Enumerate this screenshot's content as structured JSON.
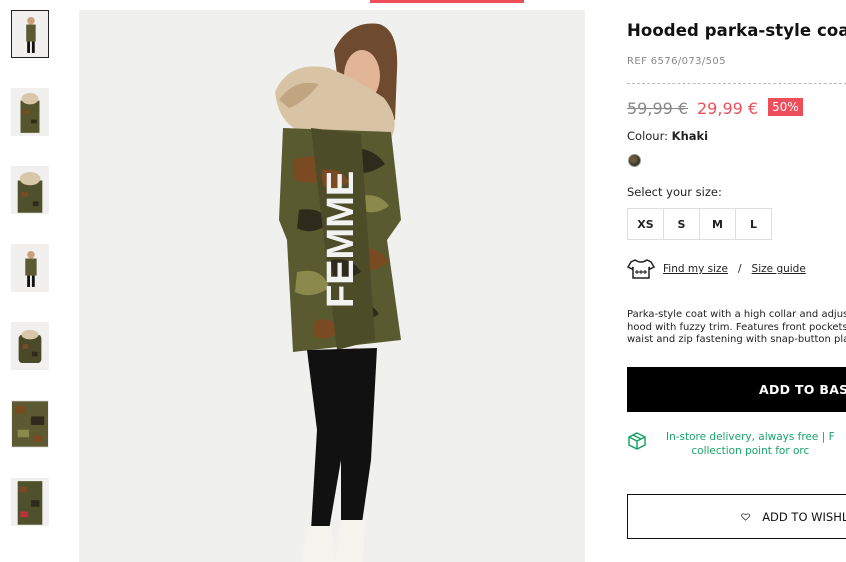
{
  "product": {
    "title": "Hooded parka-style coat",
    "ref": "REF 6576/073/505",
    "old_price": "59,99 €",
    "new_price": "29,99 €",
    "discount": "50%",
    "colour_label": "Colour:",
    "colour_value": "Khaki",
    "size_label": "Select your size:",
    "sizes": [
      "XS",
      "S",
      "M",
      "L"
    ],
    "find_size": "Find my size",
    "separator": "/",
    "size_guide": "Size guide",
    "description": "Parka-style coat with a high collar and adjustable hood with fuzzy trim. Features front pockets, fitted waist and zip fastening with snap-button placket.",
    "add_to_basket": "ADD TO BASKET",
    "delivery_line1": "In-store delivery, always free | F",
    "delivery_line2": "collection point for orc",
    "add_to_wishlist": "ADD TO WISHLIST"
  },
  "image": {
    "print_text": "FEMME"
  },
  "colors": {
    "accent": "#ee4d5a",
    "delivery": "#1aa36b",
    "camo_dark": "#3d3a22",
    "camo_mid": "#6b6a35",
    "camo_brown": "#7a4a22"
  }
}
